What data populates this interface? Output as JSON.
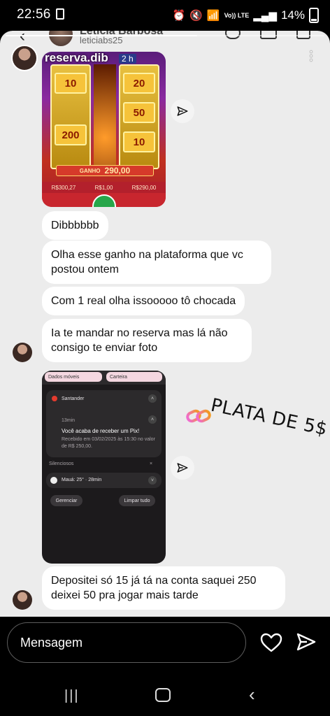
{
  "status_bar": {
    "time": "22:56",
    "battery": "14%",
    "network": "Vo)) LTE"
  },
  "dm_header": {
    "name": "Letícia Barbosa",
    "handle": "leticiabs25"
  },
  "story": {
    "username": "reserva.dib",
    "progress": 0.6
  },
  "game": {
    "ticker": "2 h",
    "tiles": [
      "10",
      "20",
      "50",
      "200",
      "10"
    ],
    "win_label": "GANHO",
    "win_value": "290,00",
    "stats": [
      "R$300,27",
      "R$1,00",
      "R$290,00"
    ]
  },
  "messages": [
    "Dibbbbbb",
    "Olha esse ganho na plataforma que vc postou ontem",
    "Com 1 real olha issooooo tô chocada",
    "Ia te mandar no reserva mas lá não consigo te enviar foto",
    "Depositei só 15 já tá na conta saquei 250 deixei 50 pra jogar mais tarde"
  ],
  "notification_shot": {
    "pill_left": "Dados móveis",
    "pill_right": "Carteira",
    "app_name": "Santander",
    "time_ago": "13min",
    "title": "Você acaba de receber um Pix!",
    "body": "Recebido em 03/02/2025 às 15:30 no valor de R$ 250,00.",
    "section": "Silenciosos",
    "weather": "Mauá: 25° · 28min",
    "btn_manage": "Gerenciar",
    "btn_clear": "Limpar tudo"
  },
  "sticker": "PLATA DE 5$",
  "composer": {
    "placeholder": "Mensagem"
  },
  "colors": {
    "bubble": "#ffffff",
    "background": "#ececec",
    "app_bg": "#000000"
  }
}
